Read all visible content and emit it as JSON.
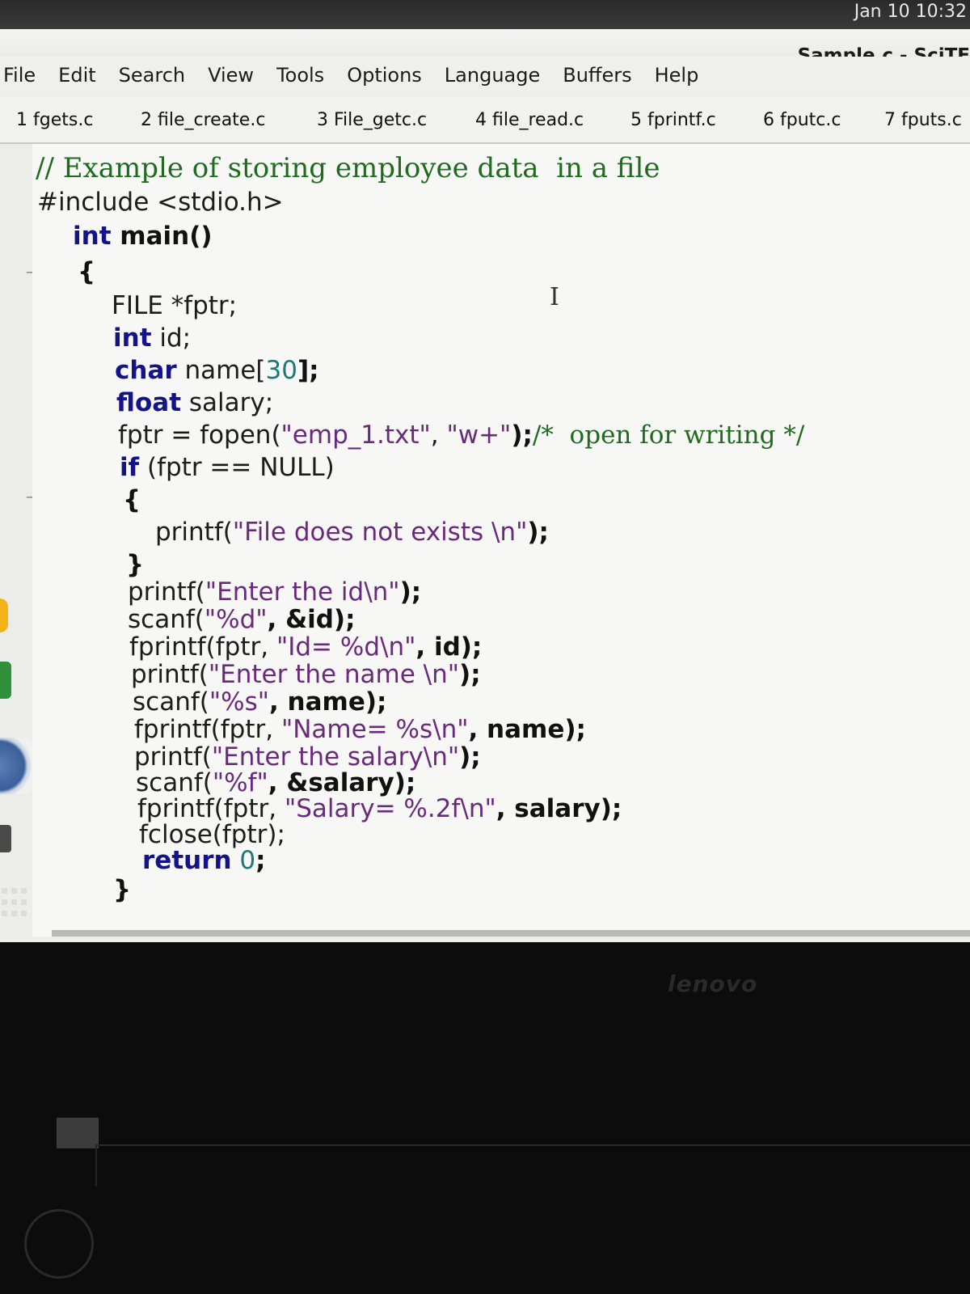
{
  "system": {
    "clock": "Jan 10  10:32"
  },
  "window": {
    "title": "Sample.c - SciTE"
  },
  "menubar": {
    "items": [
      "File",
      "Edit",
      "Search",
      "View",
      "Tools",
      "Options",
      "Language",
      "Buffers",
      "Help"
    ]
  },
  "tabs": [
    {
      "label": "1 fgets.c"
    },
    {
      "label": "2 file_create.c"
    },
    {
      "label": "3 File_getc.c"
    },
    {
      "label": "4 file_read.c"
    },
    {
      "label": "5 fprintf.c"
    },
    {
      "label": "6 fputc.c"
    },
    {
      "label": "7 fputs.c"
    }
  ],
  "code": {
    "line1": "// Example of storing employee data  in a file",
    "line2": "#include <stdio.h>",
    "line3_kw": "int",
    "line3_rest": " main()",
    "line4": "{",
    "line5": "FILE *fptr;",
    "line6_kw": "int",
    "line6_rest": " id;",
    "line7_kw": "char",
    "line7_a": " name[",
    "line7_num": "30",
    "line7_b": "];",
    "line8_kw": "float",
    "line8_rest": " salary;",
    "line9_a": "fptr = fopen(",
    "line9_s1": "\"emp_1.txt\"",
    "line9_b": ", ",
    "line9_s2": "\"w+\"",
    "line9_c": ");",
    "line9_cmt": "/*  open for writing */",
    "line10_kw": "if",
    "line10_rest": " (fptr == NULL)",
    "line11": "{",
    "line12_a": "printf(",
    "line12_s": "\"File does not exists \\n\"",
    "line12_b": ");",
    "line13": "}",
    "line14_a": "printf(",
    "line14_s": "\"Enter the id\\n\"",
    "line14_b": ");",
    "line15_a": "scanf(",
    "line15_s": "\"%d\"",
    "line15_b": ", &id);",
    "line16_a": "fprintf(fptr, ",
    "line16_s": "\"Id= %d\\n\"",
    "line16_b": ", id);",
    "line17_a": "printf(",
    "line17_s": "\"Enter the name \\n\"",
    "line17_b": ");",
    "line18_a": "scanf(",
    "line18_s": "\"%s\"",
    "line18_b": ", name);",
    "line19_a": "fprintf(fptr, ",
    "line19_s": "\"Name= %s\\n\"",
    "line19_b": ", name);",
    "line20_a": "printf(",
    "line20_s": "\"Enter the salary\\n\"",
    "line20_b": ");",
    "line21_a": "scanf(",
    "line21_s": "\"%f\"",
    "line21_b": ", &salary);",
    "line22_a": "fprintf(fptr, ",
    "line22_s": "\"Salary= %.2f\\n\"",
    "line22_b": ", salary);",
    "line23": "fclose(fptr);",
    "line24_kw": "return",
    "line24_num": " 0",
    "line24_b": ";",
    "line25": "}"
  },
  "bezel": {
    "brand": "lenovo"
  },
  "colors": {
    "keyword": "#14148a",
    "string": "#6a2a7c",
    "comment": "#1f6b1f",
    "number": "#1a7a7a"
  }
}
